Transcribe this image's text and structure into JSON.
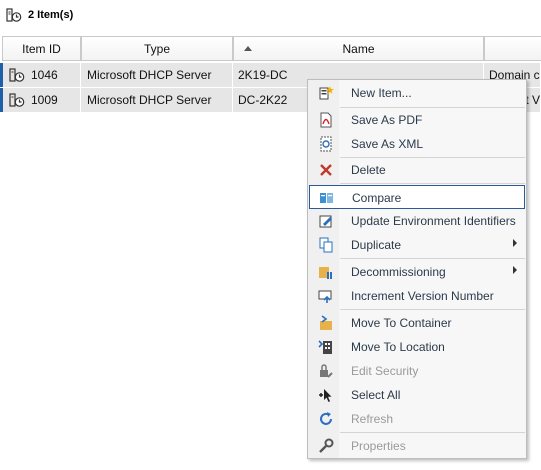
{
  "header": {
    "count_label": "2 Item(s)"
  },
  "columns": [
    "Item ID",
    "Type",
    "Name",
    ""
  ],
  "sort_column": "Name",
  "rows": [
    {
      "id": "1046",
      "type": "Microsoft DHCP Server",
      "name": "2K19-DC",
      "desc": "Domain co"
    },
    {
      "id": "1009",
      "type": "Microsoft DHCP Server",
      "name": "DC-2K22",
      "desc": "ft V"
    }
  ],
  "menu": {
    "items": [
      {
        "label": "New Item...",
        "icon": "new-item-icon",
        "disabled": false
      },
      {
        "label": "Save As PDF",
        "icon": "pdf-icon",
        "disabled": false
      },
      {
        "label": "Save As XML",
        "icon": "xml-icon",
        "disabled": false
      },
      {
        "label": "Delete",
        "icon": "delete-icon",
        "disabled": false
      },
      {
        "label": "Compare",
        "icon": "compare-icon",
        "disabled": false
      },
      {
        "label": "Update Environment Identifiers",
        "icon": "update-identifiers-icon",
        "disabled": false
      },
      {
        "label": "Duplicate",
        "icon": "duplicate-icon",
        "disabled": false
      },
      {
        "label": "Decommissioning",
        "icon": "decommission-icon",
        "disabled": false
      },
      {
        "label": "Increment Version Number",
        "icon": "increment-version-icon",
        "disabled": false
      },
      {
        "label": "Move To Container",
        "icon": "move-container-icon",
        "disabled": false
      },
      {
        "label": "Move To Location",
        "icon": "move-location-icon",
        "disabled": false
      },
      {
        "label": "Edit Security",
        "icon": "security-icon",
        "disabled": true
      },
      {
        "label": "Select All",
        "icon": "select-all-icon",
        "disabled": false
      },
      {
        "label": "Refresh",
        "icon": "refresh-icon",
        "disabled": true
      },
      {
        "label": "Properties",
        "icon": "properties-icon",
        "disabled": true
      }
    ]
  },
  "colors": {
    "accent": "#1f5fa8",
    "highlight_border": "#2a5a9b",
    "row_bg": "#e6e6e6"
  }
}
